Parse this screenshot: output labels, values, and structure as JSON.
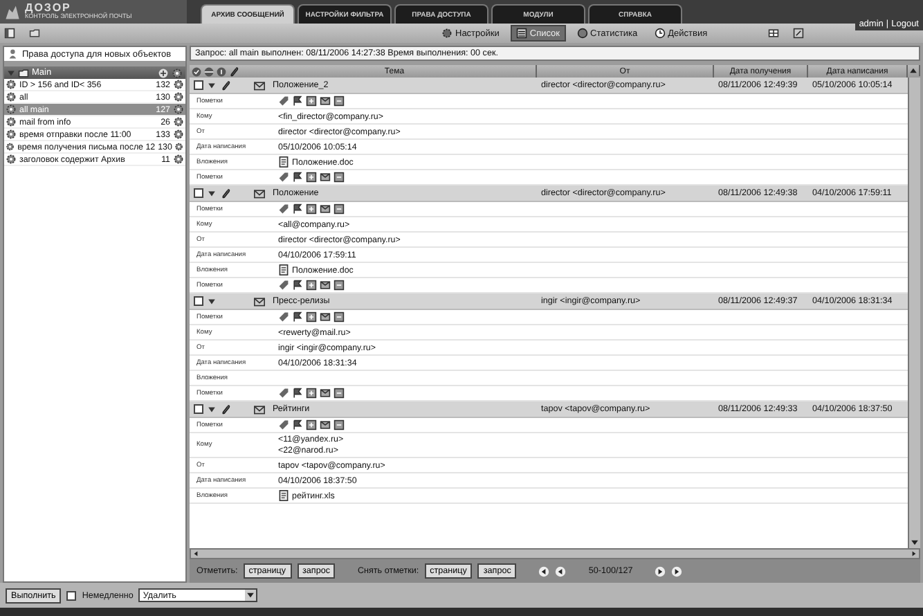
{
  "app": {
    "title": "ДОЗОР",
    "subtitle": "КОНТРОЛЬ ЭЛЕКТРОННОЙ ПОЧТЫ"
  },
  "tabs": [
    {
      "label": "АРХИВ СООБЩЕНИЙ",
      "selected": true
    },
    {
      "label": "НАСТРОЙКИ ФИЛЬТРА",
      "selected": false
    },
    {
      "label": "ПРАВА ДОСТУПА",
      "selected": false
    },
    {
      "label": "МОДУЛИ",
      "selected": false
    },
    {
      "label": "СПРАВКА",
      "selected": false
    }
  ],
  "user": {
    "name": "admin",
    "separator": "|",
    "logout": "Logout"
  },
  "toolbar": [
    {
      "label": "Настройки",
      "kind": "settings",
      "selected": false
    },
    {
      "label": "Список",
      "kind": "list",
      "selected": true
    },
    {
      "label": "Статистика",
      "kind": "stats",
      "selected": false
    },
    {
      "label": "Действия",
      "kind": "actions",
      "selected": false
    }
  ],
  "sidebar": {
    "access_link": "Права доступа для новых объектов",
    "folder": {
      "label": "Main",
      "expanded": true
    },
    "queries": [
      {
        "label": "ID > 156 and ID< 356",
        "count": "132",
        "selected": false
      },
      {
        "label": "all",
        "count": "130",
        "selected": false
      },
      {
        "label": "all main",
        "count": "127",
        "selected": true
      },
      {
        "label": "mail from info",
        "count": "26",
        "selected": false
      },
      {
        "label": "время отправки после 11:00",
        "count": "133",
        "selected": false
      },
      {
        "label": "время получения письма после 12",
        "count": "130",
        "selected": false
      },
      {
        "label": "заголовок содержит Архив",
        "count": "11",
        "selected": false
      }
    ]
  },
  "query_status": "Запрос: all main выполнен: 08/11/2006 14:27:38 Время выполнения: 00 сек.",
  "columns": [
    "Тема",
    "От",
    "Дата получения",
    "Дата написания"
  ],
  "messages": [
    {
      "subject": "Положение_2",
      "from": "director <director@company.ru>",
      "received": "08/11/2006 12:49:39",
      "written": "05/10/2006 10:05:14",
      "checked": false,
      "expanded": true,
      "has_attachment": true,
      "fields": [
        {
          "kind": "flags",
          "label": "Пометки"
        },
        {
          "kind": "text",
          "label": "Кому",
          "values": [
            "<fin_director@company.ru>"
          ]
        },
        {
          "kind": "text",
          "label": "От",
          "values": [
            "director <director@company.ru>"
          ]
        },
        {
          "kind": "text",
          "label": "Дата написания",
          "values": [
            "05/10/2006 10:05:14"
          ]
        },
        {
          "kind": "attachment",
          "label": "Вложения",
          "values": [
            "Положение.doc"
          ]
        },
        {
          "kind": "flags",
          "label": "Пометки"
        }
      ]
    },
    {
      "subject": "Положение",
      "from": "director <director@company.ru>",
      "received": "08/11/2006 12:49:38",
      "written": "04/10/2006 17:59:11",
      "checked": false,
      "expanded": true,
      "has_attachment": true,
      "fields": [
        {
          "kind": "flags",
          "label": "Пометки"
        },
        {
          "kind": "text",
          "label": "Кому",
          "values": [
            "<all@company.ru>"
          ]
        },
        {
          "kind": "text",
          "label": "От",
          "values": [
            "director <director@company.ru>"
          ]
        },
        {
          "kind": "text",
          "label": "Дата написания",
          "values": [
            "04/10/2006 17:59:11"
          ]
        },
        {
          "kind": "attachment",
          "label": "Вложения",
          "values": [
            "Положение.doc"
          ]
        },
        {
          "kind": "flags",
          "label": "Пометки"
        }
      ]
    },
    {
      "subject": "Пресс-релизы",
      "from": "ingir <ingir@company.ru>",
      "received": "08/11/2006 12:49:37",
      "written": "04/10/2006 18:31:34",
      "checked": false,
      "expanded": true,
      "has_attachment": false,
      "fields": [
        {
          "kind": "flags",
          "label": "Пометки"
        },
        {
          "kind": "text",
          "label": "Кому",
          "values": [
            "<rewerty@mail.ru>"
          ]
        },
        {
          "kind": "text",
          "label": "От",
          "values": [
            "ingir <ingir@company.ru>"
          ]
        },
        {
          "kind": "text",
          "label": "Дата написания",
          "values": [
            "04/10/2006 18:31:34"
          ]
        },
        {
          "kind": "attachment",
          "label": "Вложения"
        },
        {
          "kind": "flags",
          "label": "Пометки"
        }
      ]
    },
    {
      "subject": "Рейтинги",
      "from": "tapov <tapov@company.ru>",
      "received": "08/11/2006 12:49:33",
      "written": "04/10/2006 18:37:50",
      "checked": false,
      "expanded": true,
      "has_attachment": true,
      "fields": [
        {
          "kind": "flags",
          "label": "Пометки"
        },
        {
          "kind": "text",
          "label": "Кому",
          "values": [
            "<11@yandex.ru>",
            "<22@narod.ru>"
          ]
        },
        {
          "kind": "text",
          "label": "От",
          "values": [
            "tapov <tapov@company.ru>"
          ]
        },
        {
          "kind": "text",
          "label": "Дата написания",
          "values": [
            "04/10/2006 18:37:50"
          ]
        },
        {
          "kind": "attachment",
          "label": "Вложения",
          "values": [
            "рейтинг.xls"
          ]
        }
      ]
    }
  ],
  "marking": {
    "mark_label": "Отметить:",
    "mark_buttons": [
      "страницу",
      "запрос"
    ],
    "unmark_label": "Снять отметки:",
    "unmark_buttons": [
      "страницу",
      "запрос"
    ],
    "range": "50-100/127"
  },
  "execute": {
    "button": "Выполнить",
    "immediate": {
      "label": "Немедленно",
      "checked": false
    },
    "action": "Удалить"
  }
}
